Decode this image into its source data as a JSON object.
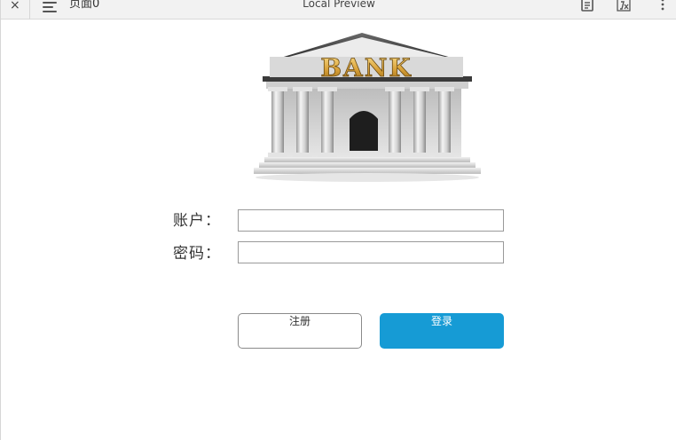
{
  "topbar": {
    "close_glyph": "×",
    "page_name": "页面0",
    "title": "Local Preview",
    "icons": [
      "close-icon",
      "menu-icon",
      "notes-icon",
      "variables-icon",
      "more-icon"
    ]
  },
  "logo": {
    "text": "BANK"
  },
  "form": {
    "account_label": "账户：",
    "account_value": "",
    "password_label": "密码：",
    "password_value": ""
  },
  "buttons": {
    "register_label": "注册",
    "login_label": "登录",
    "login_color": "#169bd5"
  }
}
